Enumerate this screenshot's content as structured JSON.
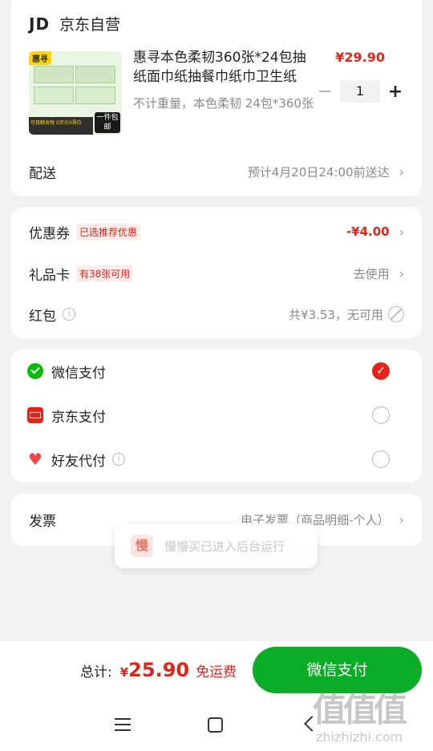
{
  "store": {
    "jd_mark": "JD",
    "name": "京东自营"
  },
  "product": {
    "badge": "惠寻",
    "thumb_caption_left": "可接触食物 0荧光0漂白",
    "thumb_caption_right": "一件包邮",
    "title": "惠寻本色柔韧360张*24包抽纸面巾纸抽餐巾纸巾卫生纸",
    "spec": "不计重量，本色柔韧 24包*360张",
    "price": "¥29.90",
    "quantity": "1",
    "minus": "−",
    "plus": "+"
  },
  "delivery": {
    "label": "配送",
    "value": "预计4月20日24:00前送达"
  },
  "coupon": {
    "label": "优惠券",
    "tag": "已选推荐优惠",
    "value": "-¥4.00"
  },
  "giftcard": {
    "label": "礼品卡",
    "tag": "有38张可用",
    "value": "去使用"
  },
  "redpacket": {
    "label": "红包",
    "value": "共¥3.53，无可用"
  },
  "payments": [
    {
      "label": "微信支付",
      "selected": true
    },
    {
      "label": "京东支付",
      "selected": false
    },
    {
      "label": "好友代付",
      "selected": false
    }
  ],
  "invoice": {
    "label": "发票",
    "value": "电子发票（商品明细-个人）"
  },
  "toast": {
    "text": "慢慢买已进入后台运行",
    "icon_char": "慢"
  },
  "footer": {
    "total_label": "总计:",
    "currency": "¥",
    "total": "25.90",
    "shipping": "免运费",
    "pay_button": "微信支付"
  },
  "watermark": "值值值",
  "watermark_url": "zhizhizhi.com",
  "colors": {
    "accent": "#e1251b",
    "wechat": "#09bb07",
    "pay_button": "#0aad25"
  }
}
